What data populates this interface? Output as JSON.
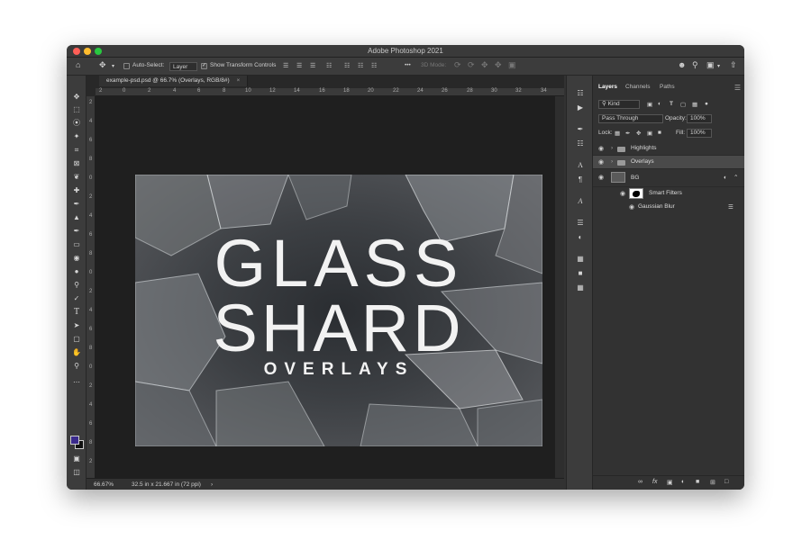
{
  "app": {
    "title": "Adobe Photoshop 2021"
  },
  "options_bar": {
    "home_icon": "home-icon",
    "move_icon": "move-icon",
    "auto_select_label": "Auto-Select:",
    "auto_select_value": "Layer",
    "show_transform_label": "Show Transform Controls",
    "more_label": "•••",
    "mode_3d_label": "3D Mode:"
  },
  "document": {
    "tab_label": "example-psd.psd @ 66.7% (Overlays, RGB/8#)",
    "ruler_h": [
      "2",
      "0",
      "2",
      "4",
      "6",
      "8",
      "10",
      "12",
      "14",
      "16",
      "18",
      "20",
      "22",
      "24",
      "26",
      "28",
      "30",
      "32",
      "34"
    ],
    "ruler_v": [
      "2",
      "4",
      "6",
      "8",
      "0",
      "2",
      "4",
      "6",
      "8",
      "0",
      "2",
      "4",
      "6",
      "8",
      "0",
      "2",
      "4",
      "6",
      "8",
      "2"
    ],
    "artwork": {
      "line1": "GLASS",
      "line2": "SHARD",
      "line3": "OVERLAYS"
    }
  },
  "status": {
    "zoom": "66.67%",
    "doc_info": "32.5 in x 21.667 in (72 ppi)",
    "arrow": "›"
  },
  "panel": {
    "tabs": [
      "Layers",
      "Channels",
      "Paths"
    ],
    "filter_kind": "Kind",
    "blend_mode": "Pass Through",
    "opacity_label": "Opacity:",
    "opacity_value": "100%",
    "lock_label": "Lock:",
    "fill_label": "Fill:",
    "fill_value": "100%",
    "layers": [
      {
        "name": "Highlights",
        "type": "group"
      },
      {
        "name": "Overlays",
        "type": "group",
        "selected": true
      },
      {
        "name": "BG",
        "type": "smart-object"
      },
      {
        "name": "Smart Filters",
        "type": "filters"
      },
      {
        "name": "Gaussian Blur",
        "type": "filter"
      }
    ],
    "bottom_icons": [
      "link-icon",
      "fx-icon",
      "mask-icon",
      "adjustment-icon",
      "group-icon",
      "new-layer-icon",
      "trash-icon"
    ],
    "fx_label": "fx"
  },
  "colors": {
    "foreground": "#3a2a8c",
    "background": "#111111",
    "accent": "#4a4a4a"
  }
}
